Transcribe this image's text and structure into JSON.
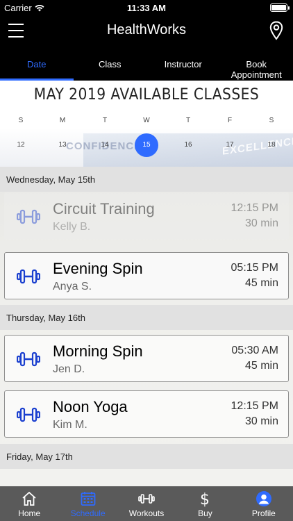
{
  "status_bar": {
    "carrier": "Carrier",
    "time": "11:33 AM"
  },
  "header": {
    "title": "HealthWorks",
    "menu_icon": "hamburger-menu-icon",
    "location_icon": "map-pin-icon"
  },
  "tabs": [
    {
      "label": "Date",
      "active": true
    },
    {
      "label": "Class",
      "active": false
    },
    {
      "label": "Instructor",
      "active": false
    },
    {
      "label": "Book Appointment",
      "active": false
    }
  ],
  "calendar": {
    "title": "MAY 2019 AVAILABLE CLASSES",
    "weekdays": [
      "S",
      "M",
      "T",
      "W",
      "T",
      "F",
      "S"
    ],
    "days": [
      "12",
      "13",
      "14",
      "15",
      "16",
      "17",
      "18"
    ],
    "selected_day": "15",
    "background_text": [
      "CONFIDENCE",
      "EXCELLENCE"
    ]
  },
  "schedule": {
    "days": [
      {
        "header": "Wednesday, May 15th",
        "classes": [
          {
            "name": "Circuit Training",
            "instructor": "Kelly B.",
            "time": "12:15 PM",
            "duration": "30 min",
            "past": true
          },
          {
            "name": "Evening Spin",
            "instructor": "Anya S.",
            "time": "05:15 PM",
            "duration": "45 min",
            "past": false
          }
        ]
      },
      {
        "header": "Thursday, May 16th",
        "classes": [
          {
            "name": "Morning Spin",
            "instructor": "Jen D.",
            "time": "05:30 AM",
            "duration": "45 min",
            "past": false
          },
          {
            "name": "Noon Yoga",
            "instructor": "Kim M.",
            "time": "12:15 PM",
            "duration": "30 min",
            "past": false
          }
        ]
      },
      {
        "header": "Friday, May 17th",
        "classes": []
      }
    ]
  },
  "bottom_nav": [
    {
      "label": "Home",
      "icon": "home-icon",
      "active": false
    },
    {
      "label": "Schedule",
      "icon": "calendar-icon",
      "active": true
    },
    {
      "label": "Workouts",
      "icon": "dumbbell-icon",
      "active": false
    },
    {
      "label": "Buy",
      "icon": "dollar-icon",
      "active": false
    },
    {
      "label": "Profile",
      "icon": "profile-icon",
      "active": false
    }
  ],
  "colors": {
    "accent": "#2f6bff",
    "header_bg": "#000000",
    "nav_bg": "#5a5a5a",
    "dumbbell": "#1a3fcf"
  }
}
